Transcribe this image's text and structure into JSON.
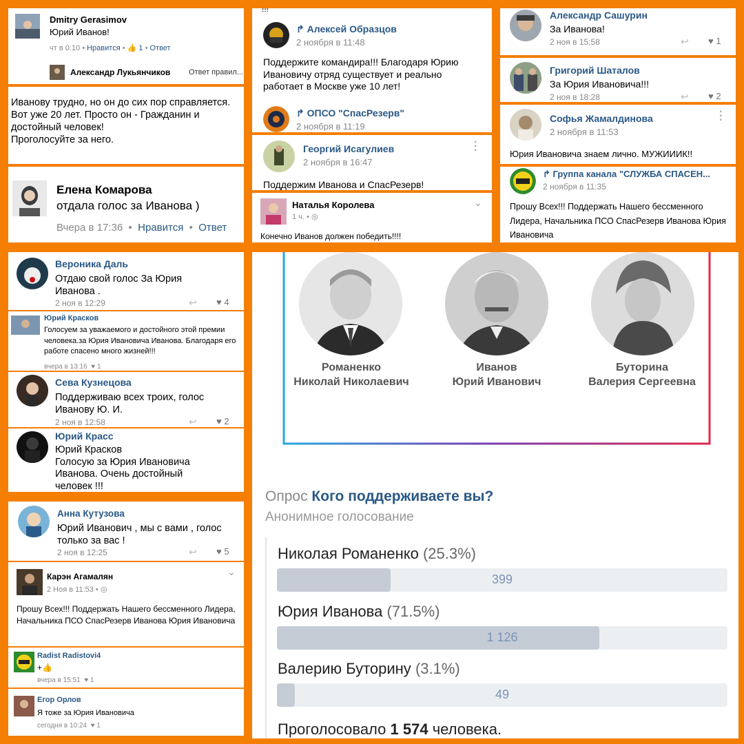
{
  "tile1": {
    "name": "Dmitry Gerasimov",
    "text": "Юрий Иванов!",
    "time": "чт в 0:10",
    "like_link": "Нравится",
    "like_count": "1",
    "reply_link": "Ответ",
    "reply_name": "Александр Лукьянчиков",
    "reply_text": "Ответ правил..."
  },
  "tile2": {
    "text": "Иванову трудно, но он до сих пор справляется. Вот уже  20 лет. Просто он - Гражданин и достойный человек!\nПроголосуйте за него."
  },
  "tile3": {
    "name": "Елена Комарова",
    "text": "отдала голос за Иванова )",
    "time": "Вчера в 17:36",
    "like_link": "Нравится",
    "reply_link": "Ответ"
  },
  "tile4": {
    "top": "!!!",
    "author": "Алексей Образцов",
    "date": "2 ноября в 11:48",
    "text": "Поддержите командира!!! Благодаря Юрию Ивановичу отряд существует и реально работает в Москве уже 10 лет!",
    "repost_name": "ОПСО \"СпасРезерв\"",
    "repost_date": "2 ноября в 11:19"
  },
  "tile5": {
    "name": "Георгий Исагулиев",
    "date": "2 ноября в 16:47",
    "text": "Поддержим Иванова и СпасРезерв!"
  },
  "tile6": {
    "name": "Наталья Королева",
    "time": "1 ч.",
    "text": "Конечно Иванов  должен победить!!!!"
  },
  "tile7": {
    "name": "Александр Сашурин",
    "text": "За Иванова!",
    "date": "2 ноя в 15:58",
    "likes": "1"
  },
  "tile8": {
    "name": "Григорий Шаталов",
    "text": "За Юрия Ивановича!!!",
    "date": "2 ноя в 18:28",
    "likes": "2"
  },
  "tile9": {
    "name": "Софья Жамалдинова",
    "date": "2 ноября в 11:53",
    "text": "Юрия Ивановича знаем лично. МУЖИИИК!!"
  },
  "tile10": {
    "name": "Группа канала \"СЛУЖБА СПАСЕН...",
    "date": "2 ноября в 11:35",
    "text": "Прошу Всех!!! Поддержать Нашего бессменного Лидера, Начальника ПСО СпасРезерв Иванова Юрия Ивановича"
  },
  "tile11": {
    "c1": {
      "name": "Вероника Даль",
      "text": "Отдаю свой голос За Юрия Иванова .",
      "date": "2 ноя в 12:29",
      "likes": "4"
    },
    "c2": {
      "name": "Юрий Красков",
      "text": "Голосуем за уважаемого и достойного этой премии человека.за Юрия Ивановича Иванова. Благодаря его работе спасено много жизней!!!",
      "date": "вчера в 13:16",
      "likes": "1"
    },
    "c3": {
      "name": "Сева Кузнецова",
      "text": "Поддерживаю всех троих, голос Иванову Ю. И.",
      "date": "2 ноя в 12:58",
      "likes": "2"
    },
    "c4": {
      "name": "Юрий Красс",
      "text": "Юрий Красков\nГолосую за Юрия Ивановича Иванова. Очень достойный человек !!!"
    }
  },
  "tile12": {
    "c1": {
      "name": "Анна Кутузова",
      "text": "Юрий Иванович , мы с вами , голос только за вас !",
      "date": "2 ноя в 12:25",
      "likes": "5"
    },
    "c2": {
      "name": "Карэн Агамалян",
      "date": "2 Ноя в 11:53",
      "text": "Прошу Всех!!! Поддержать Нашего бессменного Лидера, Начальника ПСО СпасРезерв Иванова Юрия Ивановича"
    },
    "c3": {
      "name": "Radist Radistovi4",
      "text": "+",
      "date": "вчера в 15:51",
      "likes": "1"
    },
    "c4": {
      "name": "Егор Орлов",
      "text": "Я тоже за Юрия Ивановича",
      "date": "сегодня в 10:24",
      "likes": "1"
    }
  },
  "poll": {
    "candidates": [
      {
        "line1": "Романенко",
        "line2": "Николай Николаевич"
      },
      {
        "line1": "Иванов",
        "line2": "Юрий Иванович"
      },
      {
        "line1": "Буторина",
        "line2": "Валерия Сергеевна"
      }
    ],
    "label": "Опрос",
    "question": "Кого поддерживаете вы?",
    "subtitle": "Анонимное голосование",
    "options": [
      {
        "name": "Николая Романенко",
        "percent": "(25.3%)",
        "count": "399",
        "share": 0.253
      },
      {
        "name": "Юрия Иванова",
        "percent": "(71.5%)",
        "count": "1 126",
        "share": 0.715
      },
      {
        "name": "Валерию Буторину",
        "percent": "(3.1%)",
        "count": "49",
        "share": 0.031
      }
    ],
    "total_prefix": "Проголосовало",
    "total": "1 574",
    "total_suffix": "человека."
  },
  "colors": {
    "border": "#f57e05",
    "link": "#2a5885",
    "bar_fill": "#c5ccd6",
    "bar_track": "#eceff2"
  }
}
